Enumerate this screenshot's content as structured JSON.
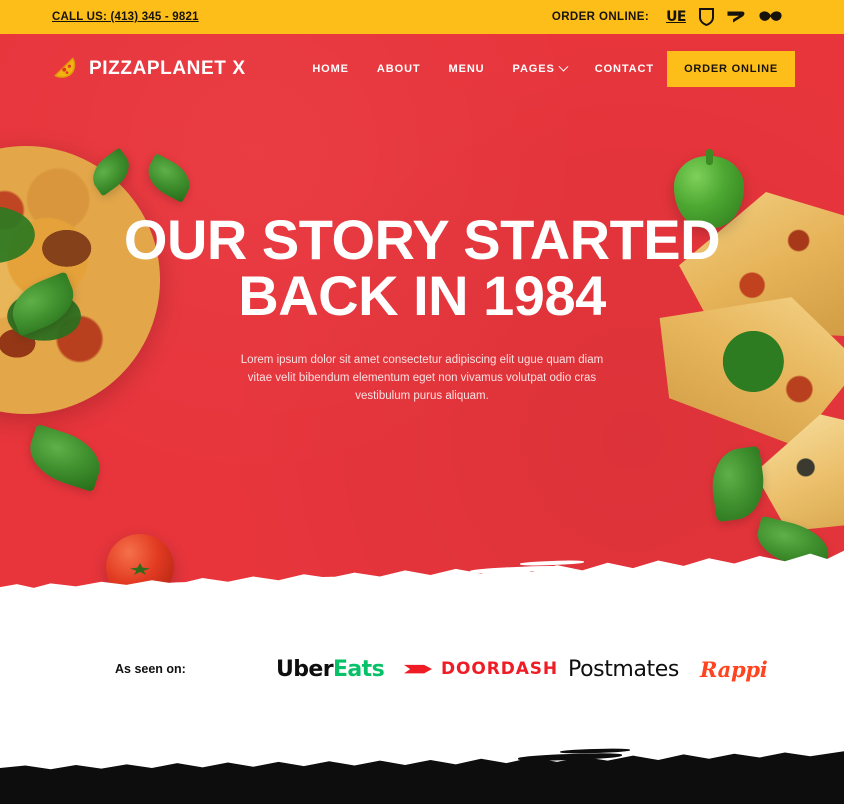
{
  "topbar": {
    "phone_label": "CALL US: (413) 345 - 9821",
    "order_online_label": "ORDER ONLINE:",
    "delivery_icons": [
      {
        "name": "uber-eats-icon",
        "glyph": "UE"
      },
      {
        "name": "doordash-icon",
        "glyph": ""
      },
      {
        "name": "postmates-icon",
        "glyph": ""
      },
      {
        "name": "grubhub-icon",
        "glyph": ""
      }
    ],
    "bg_color": "#FDBE1A",
    "text_color": "#17120C"
  },
  "nav": {
    "brand_name": "PIZZAPLANET X",
    "brand_icon": "pizza-slice-icon",
    "links": [
      {
        "label": "HOME",
        "has_dropdown": false
      },
      {
        "label": "ABOUT",
        "has_dropdown": false
      },
      {
        "label": "MENU",
        "has_dropdown": false
      },
      {
        "label": "PAGES",
        "has_dropdown": true
      },
      {
        "label": "CONTACT",
        "has_dropdown": false
      }
    ],
    "cta_label": "ORDER ONLINE",
    "cta_bg": "#FDBE1A",
    "bar_color": "#E8353C"
  },
  "hero": {
    "title": "OUR STORY STARTED BACK IN 1984",
    "subtitle": "Lorem ipsum dolor sit amet consectetur adipiscing elit ugue quam diam vitae velit bibendum elementum eget non vivamus volutpat odio cras vestibulum purus aliquam.",
    "bg_color": "#E8353C",
    "title_color": "#FFFFFF"
  },
  "brands": {
    "as_seen_label": "As seen on:",
    "logos": [
      {
        "name": "uber-eats-logo",
        "part1": "Uber",
        "part2": "Eats",
        "color1": "#0F0F0F",
        "color2": "#06C167"
      },
      {
        "name": "doordash-logo",
        "text": "DOORDASH",
        "color": "#EF1C25"
      },
      {
        "name": "postmates-logo",
        "text": "Postmates",
        "color": "#0F0F0F"
      },
      {
        "name": "rappi-logo",
        "text": "Rappi",
        "color": "#FF441F"
      }
    ]
  },
  "footer": {
    "bg_color": "#0D0D0D"
  }
}
